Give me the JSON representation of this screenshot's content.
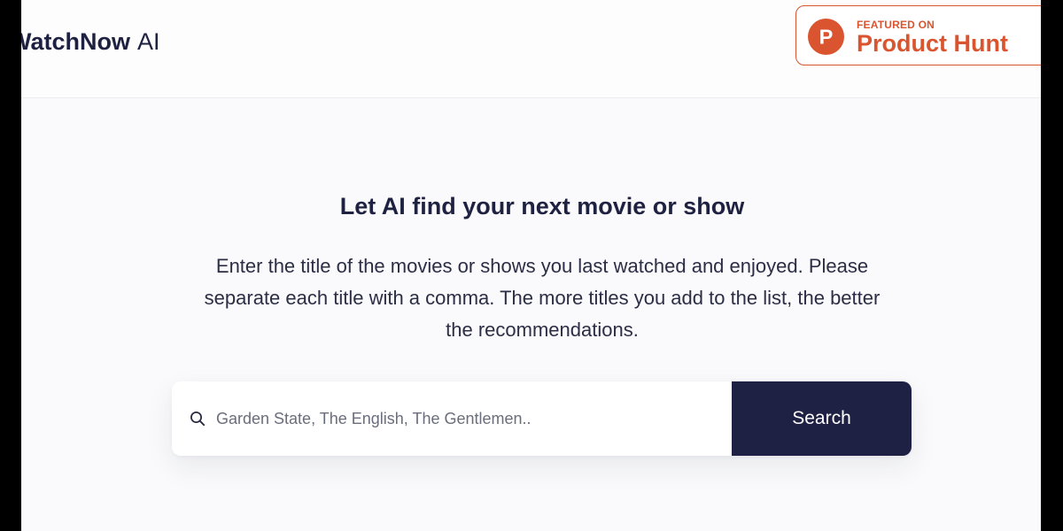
{
  "header": {
    "logo_brand": "WatchNow",
    "logo_suffix": "AI",
    "product_hunt": {
      "featured_label": "FEATURED ON",
      "name": "Product Hunt",
      "logo_letter": "P"
    }
  },
  "hero": {
    "title": "Let AI find your next movie or show",
    "description": "Enter the title of the movies or shows you last watched and enjoyed. Please separate each title with a comma. The more titles you add to the list, the better the recommendations."
  },
  "search": {
    "placeholder": "Garden State, The English, The Gentlemen..",
    "value": "",
    "button_label": "Search",
    "icon": "search-icon"
  },
  "colors": {
    "primary": "#1f2144",
    "product_hunt": "#da552f",
    "background": "#fafafc"
  }
}
